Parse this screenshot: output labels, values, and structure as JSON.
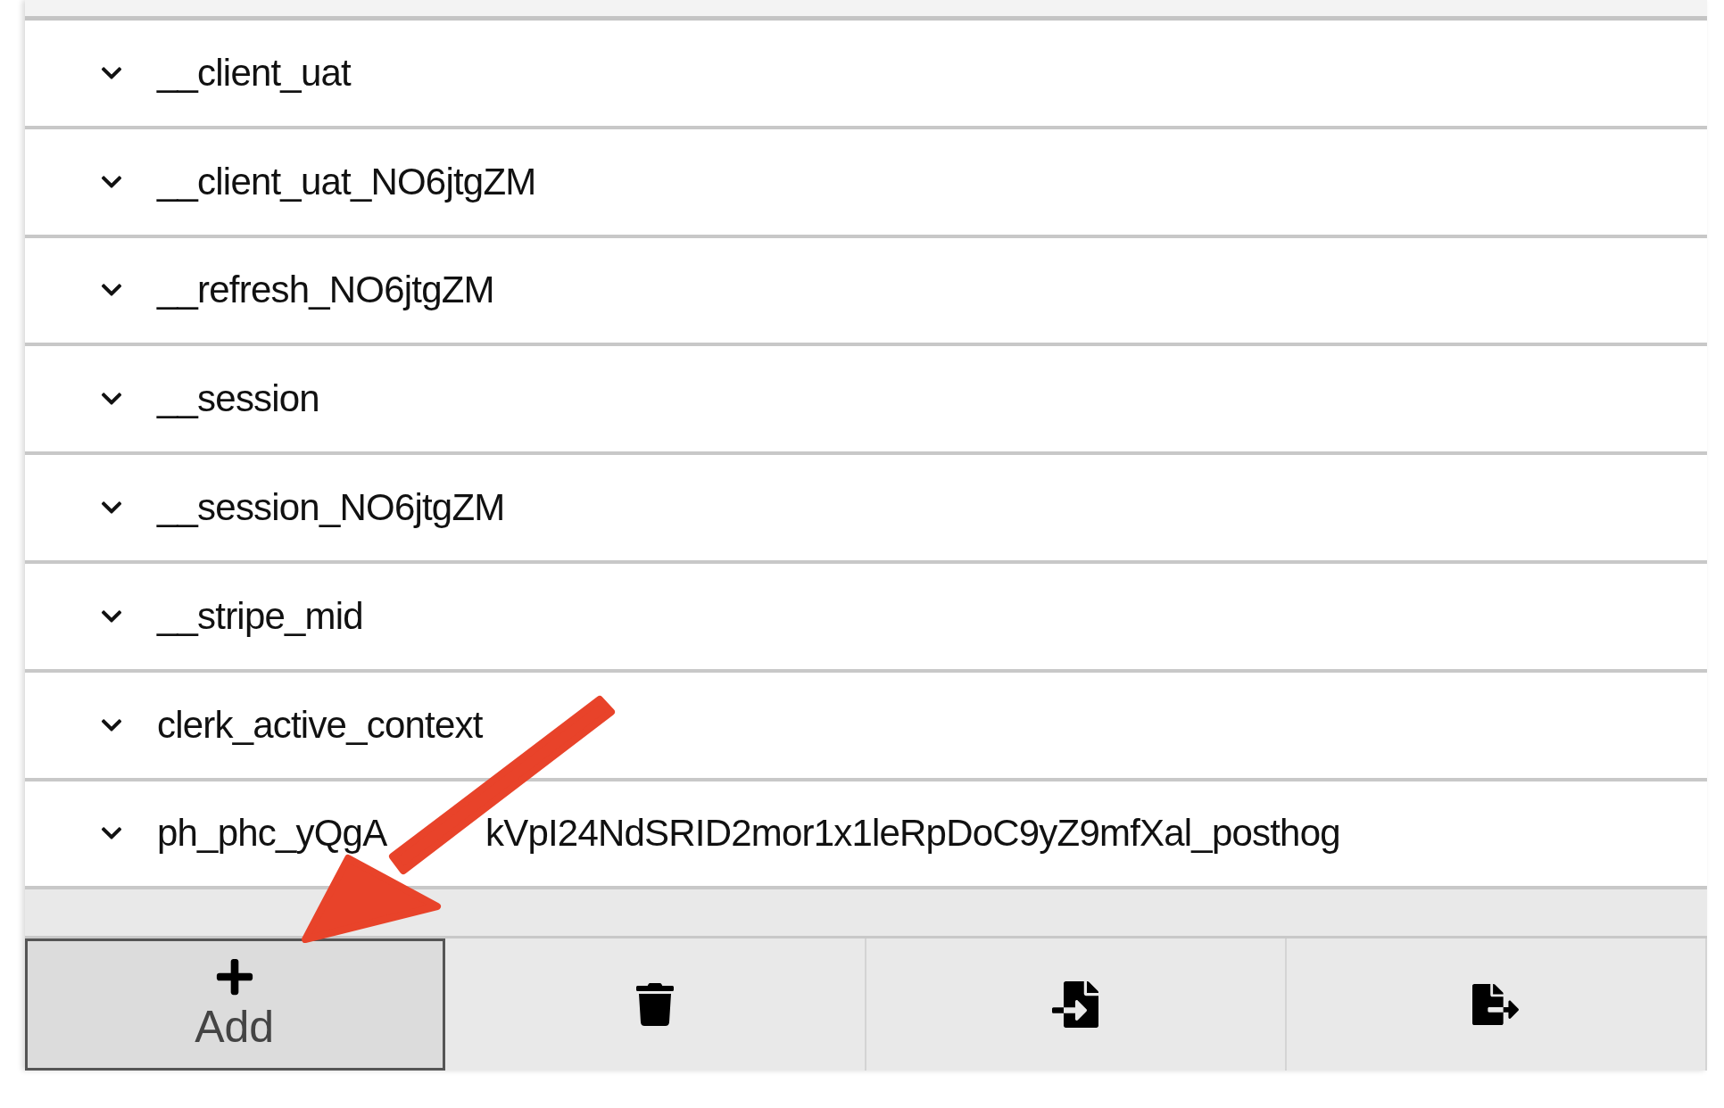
{
  "cookies": [
    {
      "name": "__client_uat",
      "expanded": false
    },
    {
      "name": "__client_uat_NO6jtgZM",
      "expanded": false
    },
    {
      "name": "__refresh_NO6jtgZM",
      "expanded": false
    },
    {
      "name": "__session",
      "expanded": false
    },
    {
      "name": "__session_NO6jtgZM",
      "expanded": false
    },
    {
      "name": "__stripe_mid",
      "expanded": false
    },
    {
      "name": "clerk_active_context",
      "expanded": false
    },
    {
      "name": "ph_phc_yQgA",
      "name_after_arrow": "kVpI24NdSRID2mor1x1leRpDoC9yZ9mfXal_posthog",
      "expanded": false
    }
  ],
  "toolbar": [
    {
      "kind": "add",
      "label": "Add",
      "selected": true
    },
    {
      "kind": "delete",
      "selected": false
    },
    {
      "kind": "import",
      "selected": false
    },
    {
      "kind": "export",
      "selected": false
    }
  ]
}
